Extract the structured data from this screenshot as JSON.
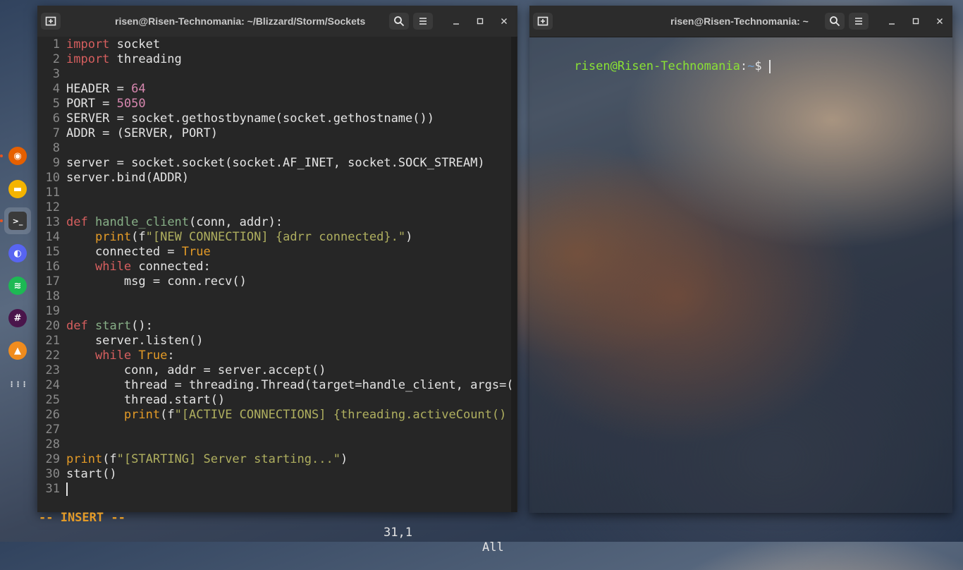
{
  "dock": {
    "items": [
      {
        "name": "firefox",
        "icon": "firefox-icon",
        "color": "#e66000",
        "glyph": "◉"
      },
      {
        "name": "files",
        "icon": "folder-icon",
        "color": "#f4b400",
        "glyph": "▬"
      },
      {
        "name": "terminal",
        "icon": "terminal-icon",
        "color": "#3a3a3a",
        "glyph": ">_"
      },
      {
        "name": "discord",
        "icon": "discord-icon",
        "color": "#5865f2",
        "glyph": "◐"
      },
      {
        "name": "spotify",
        "icon": "spotify-icon",
        "color": "#1db954",
        "glyph": "≋"
      },
      {
        "name": "slack",
        "icon": "slack-icon",
        "color": "#4a154b",
        "glyph": "#"
      },
      {
        "name": "vlc",
        "icon": "vlc-icon",
        "color": "#f08c1e",
        "glyph": "▲"
      },
      {
        "name": "show-apps",
        "icon": "app-grid-icon",
        "color": "transparent",
        "glyph": "⋮⋮⋮"
      }
    ]
  },
  "editor": {
    "title": "risen@Risen-Technomania: ~/Blizzard/Storm/Sockets",
    "lines": [
      [
        {
          "t": "kw",
          "v": "import"
        },
        {
          "t": "text",
          "v": " socket"
        }
      ],
      [
        {
          "t": "kw",
          "v": "import"
        },
        {
          "t": "text",
          "v": " threading"
        }
      ],
      [],
      [
        {
          "t": "text",
          "v": "HEADER = "
        },
        {
          "t": "num",
          "v": "64"
        }
      ],
      [
        {
          "t": "text",
          "v": "PORT = "
        },
        {
          "t": "num",
          "v": "5050"
        }
      ],
      [
        {
          "t": "text",
          "v": "SERVER = socket.gethostbyname(socket.gethostname())"
        }
      ],
      [
        {
          "t": "text",
          "v": "ADDR = (SERVER, PORT)"
        }
      ],
      [],
      [
        {
          "t": "text",
          "v": "server = socket.socket(socket.AF_INET, socket.SOCK_STREAM)"
        }
      ],
      [
        {
          "t": "text",
          "v": "server.bind(ADDR)"
        }
      ],
      [],
      [],
      [
        {
          "t": "kw",
          "v": "def"
        },
        {
          "t": "text",
          "v": " "
        },
        {
          "t": "fn",
          "v": "handle_client"
        },
        {
          "t": "text",
          "v": "(conn, addr):"
        }
      ],
      [
        {
          "t": "text",
          "v": "    "
        },
        {
          "t": "bi",
          "v": "print"
        },
        {
          "t": "text",
          "v": "(f"
        },
        {
          "t": "str",
          "v": "\"[NEW CONNECTION] {adrr connected}.\""
        },
        {
          "t": "text",
          "v": ")"
        }
      ],
      [
        {
          "t": "text",
          "v": "    connected = "
        },
        {
          "t": "bool",
          "v": "True"
        }
      ],
      [
        {
          "t": "text",
          "v": "    "
        },
        {
          "t": "kw",
          "v": "while"
        },
        {
          "t": "text",
          "v": " connected:"
        }
      ],
      [
        {
          "t": "text",
          "v": "        msg = conn.recv()"
        }
      ],
      [],
      [],
      [
        {
          "t": "kw",
          "v": "def"
        },
        {
          "t": "text",
          "v": " "
        },
        {
          "t": "fn",
          "v": "start"
        },
        {
          "t": "text",
          "v": "():"
        }
      ],
      [
        {
          "t": "text",
          "v": "    server.listen()"
        }
      ],
      [
        {
          "t": "text",
          "v": "    "
        },
        {
          "t": "kw",
          "v": "while"
        },
        {
          "t": "text",
          "v": " "
        },
        {
          "t": "bool",
          "v": "True"
        },
        {
          "t": "text",
          "v": ":"
        }
      ],
      [
        {
          "t": "text",
          "v": "        conn, addr = server.accept()"
        }
      ],
      [
        {
          "t": "text",
          "v": "        thread = threading.Thread(target=handle_client, args=(c"
        }
      ],
      [
        {
          "t": "text",
          "v": "        thread.start()"
        }
      ],
      [
        {
          "t": "text",
          "v": "        "
        },
        {
          "t": "bi",
          "v": "print"
        },
        {
          "t": "text",
          "v": "(f"
        },
        {
          "t": "str",
          "v": "\"[ACTIVE CONNECTIONS] {threading.activeCount() -"
        }
      ],
      [],
      [],
      [
        {
          "t": "bi",
          "v": "print"
        },
        {
          "t": "text",
          "v": "(f"
        },
        {
          "t": "str",
          "v": "\"[STARTING] Server starting...\""
        },
        {
          "t": "text",
          "v": ")"
        }
      ],
      [
        {
          "t": "text",
          "v": "start()"
        }
      ],
      []
    ],
    "status": {
      "mode": "-- INSERT --",
      "position": "31,1",
      "scroll": "All"
    }
  },
  "terminal": {
    "title": "risen@Risen-Technomania: ~",
    "prompt_user": "risen@Risen-Technomania",
    "prompt_sep": ":",
    "prompt_dir": "~",
    "prompt_symbol": "$"
  },
  "colors": {
    "prompt_user": "#8ae234",
    "prompt_dir": "#729fcf",
    "mode": "#e49b27"
  }
}
